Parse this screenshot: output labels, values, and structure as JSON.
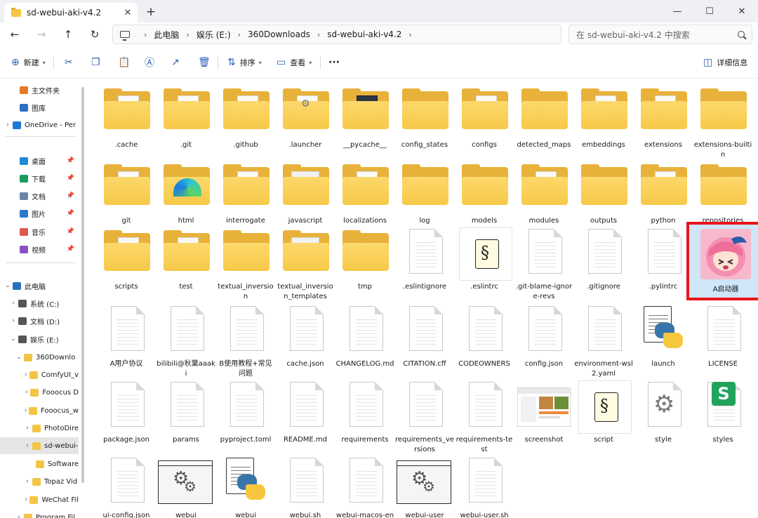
{
  "window": {
    "tab_title": "sd-webui-aki-v4.2",
    "close_tab": "✕",
    "new_tab": "+",
    "min": "—",
    "max": "☐",
    "close": "✕"
  },
  "nav": {
    "back": "←",
    "forward": "→",
    "up": "↑",
    "refresh": "↻"
  },
  "breadcrumb": [
    "此电脑",
    "娱乐 (E:)",
    "360Downloads",
    "sd-webui-aki-v4.2"
  ],
  "search": {
    "placeholder": "在 sd-webui-aki-v4.2 中搜索"
  },
  "toolbar": {
    "new_label": "新建",
    "sort_label": "排序",
    "view_label": "查看",
    "more_label": "···",
    "details_label": "详细信息"
  },
  "sidebar": [
    {
      "label": "主文件夹",
      "icon": "home-icon",
      "color": "#e57a2a",
      "chevron": ""
    },
    {
      "label": "图库",
      "icon": "gallery-icon",
      "color": "#2c6fc4",
      "chevron": ""
    },
    {
      "label": "OneDrive - Per",
      "icon": "cloud-icon",
      "color": "#1d79d6",
      "chevron": "›"
    },
    {
      "label": "桌面",
      "icon": "desktop-icon",
      "color": "#1f8ad8",
      "chevron": "",
      "pin": "📌"
    },
    {
      "label": "下载",
      "icon": "download-icon",
      "color": "#1b9a5e",
      "chevron": "",
      "pin": "📌"
    },
    {
      "label": "文档",
      "icon": "documents-icon",
      "color": "#6b86a8",
      "chevron": "",
      "pin": "📌"
    },
    {
      "label": "图片",
      "icon": "pictures-icon",
      "color": "#2c79c9",
      "chevron": "",
      "pin": "📌"
    },
    {
      "label": "音乐",
      "icon": "music-icon",
      "color": "#e2544d",
      "chevron": "",
      "pin": "📌"
    },
    {
      "label": "视频",
      "icon": "videos-icon",
      "color": "#8a4fc6",
      "chevron": "",
      "pin": "📌"
    },
    {
      "label": "此电脑",
      "icon": "this-pc-icon",
      "color": "#2a6fbe",
      "chevron": "⌄"
    },
    {
      "label": "系统 (C:)",
      "icon": "drive-icon",
      "color": "#555555",
      "chevron": "›"
    },
    {
      "label": "文档 (D:)",
      "icon": "drive-icon",
      "color": "#555555",
      "chevron": "›"
    },
    {
      "label": "娱乐 (E:)",
      "icon": "drive-icon",
      "color": "#555555",
      "chevron": "⌄"
    },
    {
      "label": "360Downlo",
      "icon": "folder-icon",
      "color": "#f3c544",
      "chevron": "⌄"
    },
    {
      "label": "ComfyUI_v",
      "icon": "folder-icon",
      "color": "#f3c544",
      "chevron": "›"
    },
    {
      "label": "Fooocus D",
      "icon": "folder-icon",
      "color": "#f3c544",
      "chevron": "›"
    },
    {
      "label": "Fooocus_w",
      "icon": "folder-icon",
      "color": "#f3c544",
      "chevron": "›"
    },
    {
      "label": "PhotoDire",
      "icon": "folder-icon",
      "color": "#f3c544",
      "chevron": "›"
    },
    {
      "label": "sd-webui-",
      "icon": "folder-icon",
      "color": "#f3c544",
      "chevron": "›",
      "selected": true
    },
    {
      "label": "Software",
      "icon": "folder-icon",
      "color": "#f3c544",
      "chevron": ""
    },
    {
      "label": "Topaz Vid",
      "icon": "folder-icon",
      "color": "#f3c544",
      "chevron": "›"
    },
    {
      "label": "WeChat Fil",
      "icon": "folder-icon",
      "color": "#f3c544",
      "chevron": "›"
    },
    {
      "label": "Program Fil",
      "icon": "folder-icon",
      "color": "#f3c544",
      "chevron": "›"
    }
  ],
  "files": [
    {
      "name": ".cache",
      "kind": "folder",
      "mark": "doc"
    },
    {
      "name": ".git",
      "kind": "folder",
      "mark": "doc"
    },
    {
      "name": ".github",
      "kind": "folder",
      "mark": "doc"
    },
    {
      "name": ".launcher",
      "kind": "folder",
      "mark": "gear"
    },
    {
      "name": "__pycache__",
      "kind": "folder",
      "mark": "dark"
    },
    {
      "name": "config_states",
      "kind": "folder",
      "mark": "none"
    },
    {
      "name": "configs",
      "kind": "folder",
      "mark": "doc"
    },
    {
      "name": "detected_maps",
      "kind": "folder",
      "mark": "none"
    },
    {
      "name": "embeddings",
      "kind": "folder",
      "mark": "doc"
    },
    {
      "name": "extensions",
      "kind": "folder",
      "mark": "doc"
    },
    {
      "name": "extensions-builtin",
      "kind": "folder",
      "mark": "none"
    },
    {
      "name": "git",
      "kind": "folder",
      "mark": "doc"
    },
    {
      "name": "html",
      "kind": "folder",
      "mark": "edge"
    },
    {
      "name": "interrogate",
      "kind": "folder",
      "mark": "doc"
    },
    {
      "name": "javascript",
      "kind": "folder",
      "mark": "alt"
    },
    {
      "name": "localizations",
      "kind": "folder",
      "mark": "doc"
    },
    {
      "name": "log",
      "kind": "folder",
      "mark": "none"
    },
    {
      "name": "models",
      "kind": "folder",
      "mark": "none"
    },
    {
      "name": "modules",
      "kind": "folder",
      "mark": "doc"
    },
    {
      "name": "outputs",
      "kind": "folder",
      "mark": "none"
    },
    {
      "name": "python",
      "kind": "folder",
      "mark": "doc"
    },
    {
      "name": "repositories",
      "kind": "folder",
      "mark": "none"
    },
    {
      "name": "scripts",
      "kind": "folder",
      "mark": "doc"
    },
    {
      "name": "test",
      "kind": "folder",
      "mark": "doc"
    },
    {
      "name": "textual_inversion",
      "kind": "folder",
      "mark": "none"
    },
    {
      "name": "textual_inversion_templates",
      "kind": "folder",
      "mark": "alt"
    },
    {
      "name": "tmp",
      "kind": "folder",
      "mark": "none"
    },
    {
      "name": ".eslintignore",
      "kind": "doc"
    },
    {
      "name": ".eslintrc",
      "kind": "script"
    },
    {
      "name": ".git-blame-ignore-revs",
      "kind": "doc"
    },
    {
      "name": ".gitignore",
      "kind": "doc"
    },
    {
      "name": ".pylintrc",
      "kind": "doc"
    },
    {
      "name": "A启动器",
      "kind": "avatar",
      "highlight": true
    },
    {
      "name": "A用户协议",
      "kind": "doc"
    },
    {
      "name": "bilibili@秋葉aaaki",
      "kind": "doc"
    },
    {
      "name": "B使用教程+常见问题",
      "kind": "doc"
    },
    {
      "name": "cache.json",
      "kind": "doc"
    },
    {
      "name": "CHANGELOG.md",
      "kind": "doc"
    },
    {
      "name": "CITATION.cff",
      "kind": "doc"
    },
    {
      "name": "CODEOWNERS",
      "kind": "doc"
    },
    {
      "name": "config.json",
      "kind": "doc"
    },
    {
      "name": "environment-wsl2.yaml",
      "kind": "doc"
    },
    {
      "name": "launch",
      "kind": "python"
    },
    {
      "name": "LICENSE",
      "kind": "doc"
    },
    {
      "name": "package.json",
      "kind": "doc"
    },
    {
      "name": "params",
      "kind": "doc"
    },
    {
      "name": "pyproject.toml",
      "kind": "doc"
    },
    {
      "name": "README.md",
      "kind": "doc"
    },
    {
      "name": "requirements",
      "kind": "doc"
    },
    {
      "name": "requirements_versions",
      "kind": "doc"
    },
    {
      "name": "requirements-test",
      "kind": "doc"
    },
    {
      "name": "screenshot",
      "kind": "screenshot"
    },
    {
      "name": "script",
      "kind": "script"
    },
    {
      "name": "style",
      "kind": "gearpage"
    },
    {
      "name": "styles",
      "kind": "sheet"
    },
    {
      "name": "ui-config.json",
      "kind": "doc"
    },
    {
      "name": "webui",
      "kind": "exe"
    },
    {
      "name": "webui",
      "kind": "python"
    },
    {
      "name": "webui.sh",
      "kind": "doc"
    },
    {
      "name": "webui-macos-env.sh",
      "kind": "doc"
    },
    {
      "name": "webui-user",
      "kind": "exe"
    },
    {
      "name": "webui-user.sh",
      "kind": "doc"
    }
  ]
}
